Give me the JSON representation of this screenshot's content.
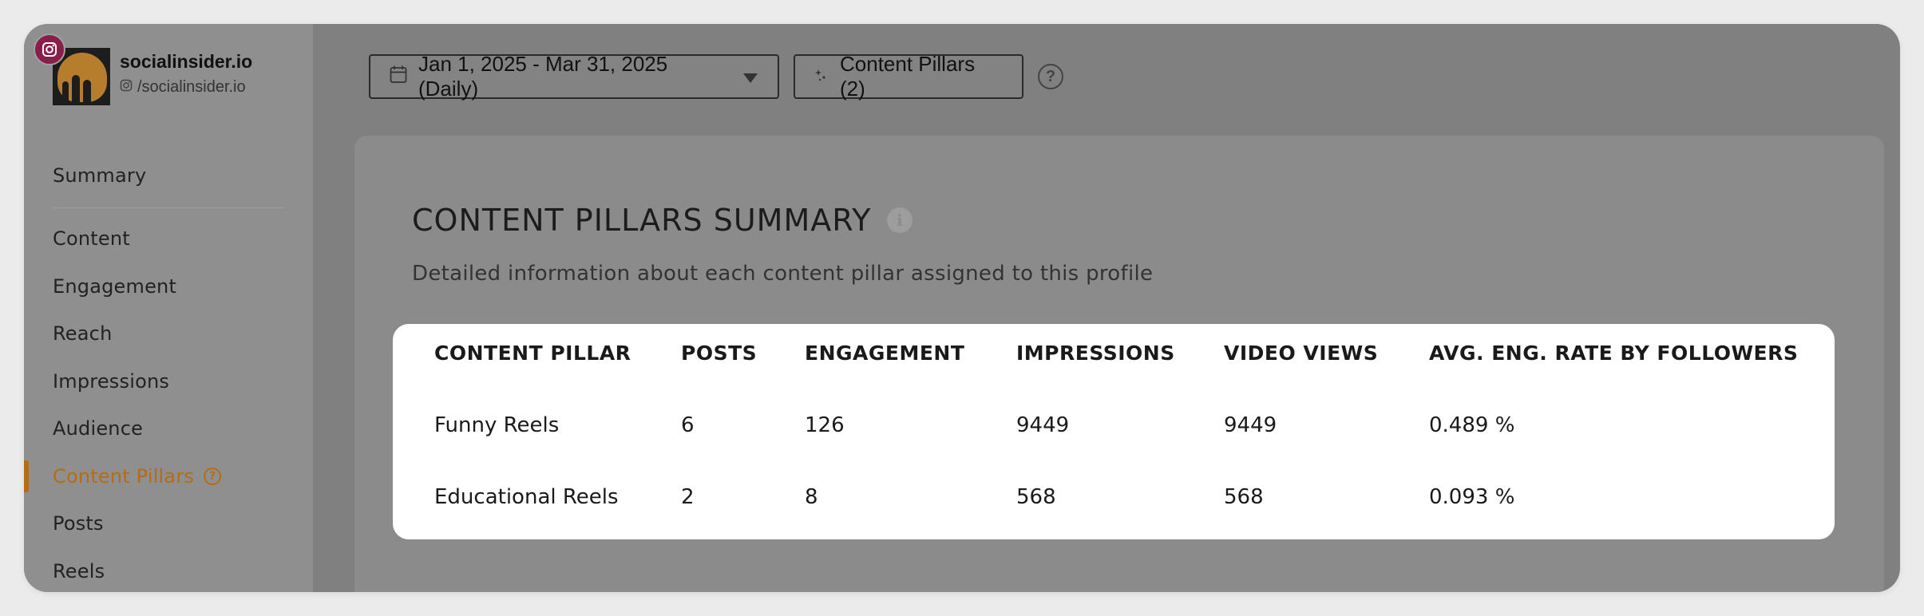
{
  "profile": {
    "name": "socialinsider.io",
    "handle": "/socialinsider.io"
  },
  "sidebar": {
    "items": [
      {
        "label": "Summary"
      },
      {
        "label": "Content"
      },
      {
        "label": "Engagement"
      },
      {
        "label": "Reach"
      },
      {
        "label": "Impressions"
      },
      {
        "label": "Audience"
      },
      {
        "label": "Content Pillars",
        "active": true
      },
      {
        "label": "Posts"
      },
      {
        "label": "Reels"
      }
    ]
  },
  "toolbar": {
    "date_range": "Jan 1, 2025 - Mar 31, 2025 (Daily)",
    "pillars_button": "Content Pillars (2)",
    "help": "?"
  },
  "panel": {
    "title": "CONTENT PILLARS SUMMARY",
    "subtitle": "Detailed information about each content pillar assigned to this profile"
  },
  "table": {
    "columns": [
      "CONTENT PILLAR",
      "POSTS",
      "ENGAGEMENT",
      "IMPRESSIONS",
      "VIDEO VIEWS",
      "AVG. ENG. RATE BY FOLLOWERS"
    ],
    "rows": [
      [
        "Funny Reels",
        "6",
        "126",
        "9449",
        "9449",
        "0.489 %"
      ],
      [
        "Educational Reels",
        "2",
        "8",
        "568",
        "568",
        "0.093 %"
      ]
    ]
  },
  "colors": {
    "accent": "#b56d15",
    "instagram_badge": "#8a1d4a"
  }
}
